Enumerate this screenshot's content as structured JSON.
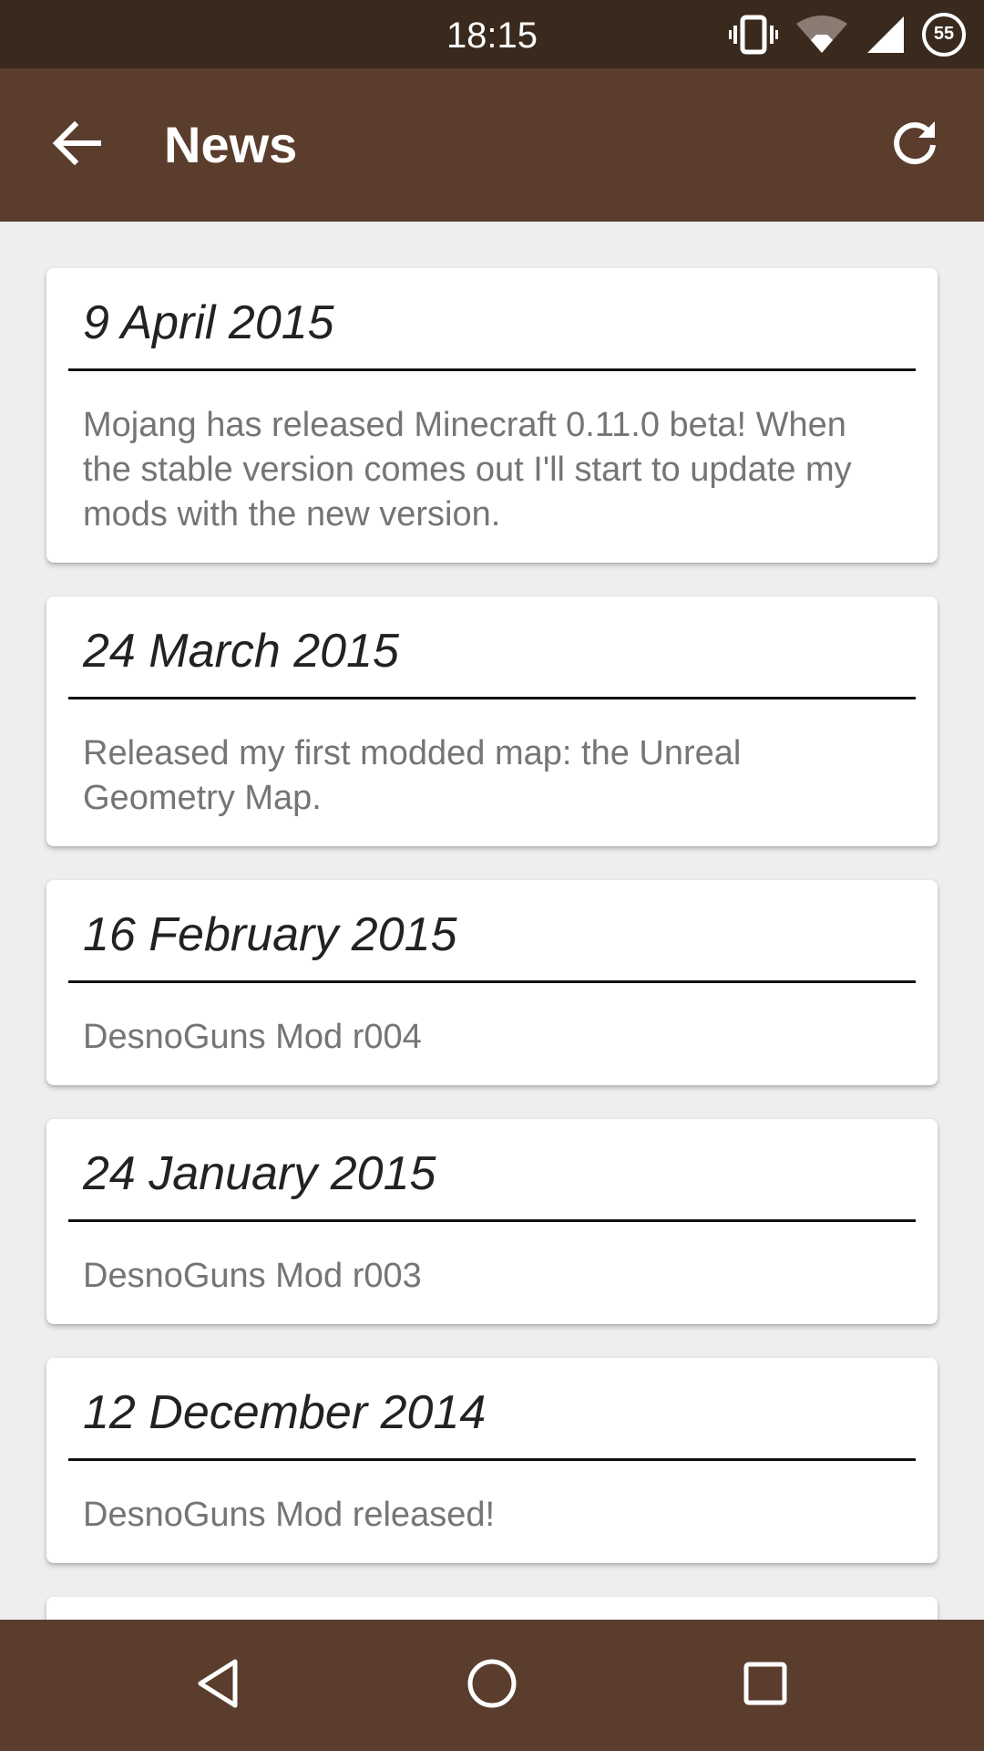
{
  "status_bar": {
    "time": "18:15",
    "battery_level": "55",
    "icons": [
      "vibrate-icon",
      "wifi-icon",
      "signal-icon",
      "battery-icon"
    ]
  },
  "app_bar": {
    "title": "News",
    "back_icon": "arrow-back-icon",
    "refresh_icon": "refresh-icon"
  },
  "news": [
    {
      "date": "9 April 2015",
      "body": "Mojang has released Minecraft 0.11.0 beta! When the stable version comes out I'll start to update my mods with the new version."
    },
    {
      "date": "24 March 2015",
      "body": "Released my first modded map: the Unreal Geometry Map."
    },
    {
      "date": "16 February 2015",
      "body": "DesnoGuns Mod r004"
    },
    {
      "date": "24 January 2015",
      "body": "DesnoGuns Mod r003"
    },
    {
      "date": "12 December 2014",
      "body": "DesnoGuns Mod released!"
    }
  ],
  "nav_bar": {
    "icons": [
      "back-triangle-icon",
      "home-circle-icon",
      "recents-square-icon"
    ]
  },
  "colors": {
    "status_bar": "#3a2a1e",
    "app_bar": "#5a3d2c",
    "background": "#eeeeee",
    "card": "#ffffff"
  }
}
